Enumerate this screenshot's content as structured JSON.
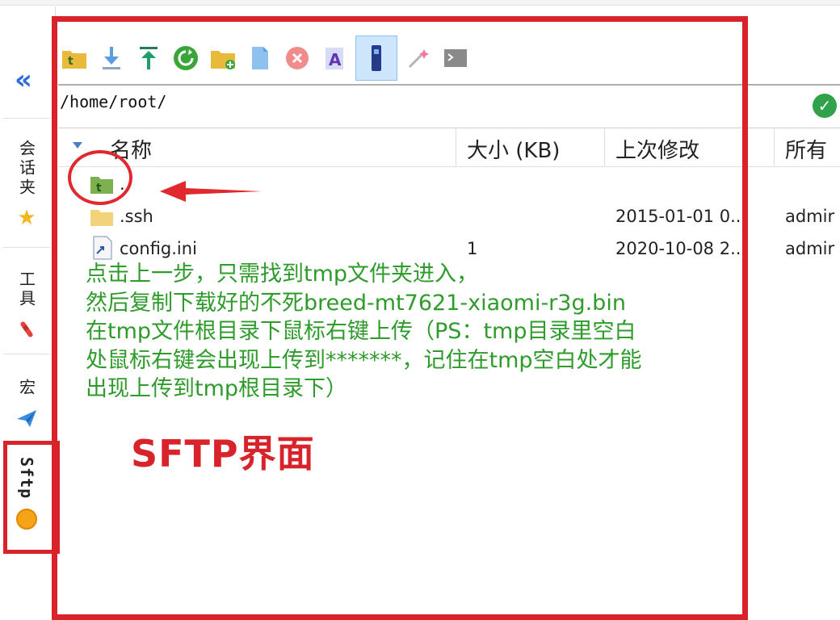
{
  "sidebar": {
    "tabs": [
      {
        "label": "会话夹",
        "icon": "star-icon"
      },
      {
        "label": "工具",
        "icon": "tools-icon"
      },
      {
        "label": "宏",
        "icon": "paper-plane-icon"
      },
      {
        "label": "Sftp",
        "icon": "sftp-circle-icon"
      }
    ]
  },
  "toolbar": {
    "buttons": [
      "parent-folder-icon",
      "download-icon",
      "upload-icon",
      "refresh-icon",
      "new-folder-icon",
      "new-file-icon",
      "delete-icon",
      "rename-icon",
      "terminal-sync-icon",
      "magic-wand-icon",
      "console-icon"
    ],
    "active": "terminal-sync-icon"
  },
  "path": {
    "value": "/home/root/"
  },
  "columns": {
    "name": "名称",
    "size": "大小 (KB)",
    "modified": "上次修改",
    "owner": "所有"
  },
  "files": [
    {
      "name": "..",
      "size": "",
      "modified": "",
      "owner": "",
      "icon": "parent-folder-icon"
    },
    {
      "name": ".ssh",
      "size": "",
      "modified": "2015-01-01 0...",
      "owner": "admir",
      "icon": "folder-icon"
    },
    {
      "name": "config.ini",
      "size": "1",
      "modified": "2020-10-08 2...",
      "owner": "admir",
      "icon": "shortcut-file-icon"
    }
  ],
  "annotation": {
    "lines": [
      "点击上一步，只需找到tmp文件夹进入，",
      "然后复制下载好的不死breed-mt7621-xiaomi-r3g.bin",
      "在tmp文件根目录下鼠标右键上传（PS：tmp目录里空白",
      "处鼠标右键会出现上传到*******，记住在tmp空白处才能",
      "出现上传到tmp根目录下）"
    ],
    "caption": "SFTP界面",
    "colors": {
      "text": "#2e9b2b",
      "highlight": "#d8232a"
    }
  }
}
